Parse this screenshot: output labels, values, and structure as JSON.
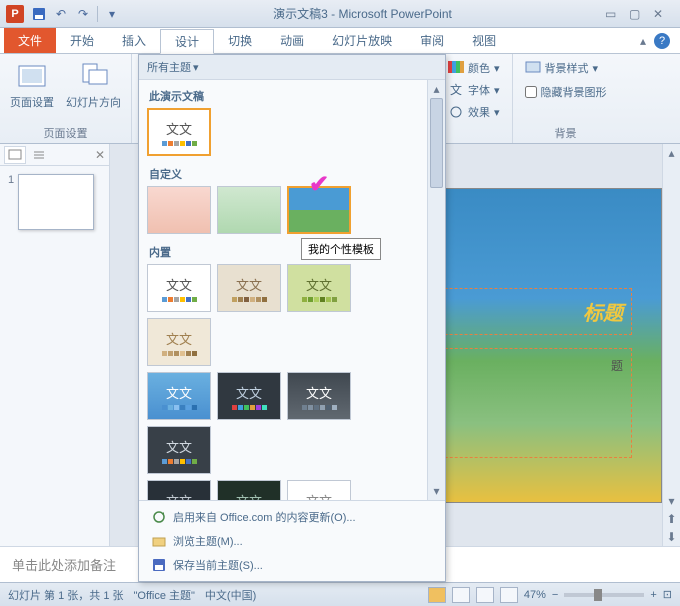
{
  "title": "演示文稿3 - Microsoft PowerPoint",
  "tabs": {
    "file": "文件",
    "home": "开始",
    "insert": "插入",
    "design": "设计",
    "transitions": "切换",
    "animations": "动画",
    "slideshow": "幻灯片放映",
    "review": "审阅",
    "view": "视图"
  },
  "ribbon": {
    "page_setup_group": "页面设置",
    "page_setup": "页面设置",
    "slide_orientation": "幻灯片方向",
    "colors": "颜色",
    "fonts": "字体",
    "effects": "效果",
    "bg_styles": "背景样式",
    "hide_bg_graphics": "隐藏背景图形",
    "background_group": "背景"
  },
  "gallery": {
    "all_themes": "所有主题",
    "this_presentation": "此演示文稿",
    "custom": "自定义",
    "builtin": "内置",
    "thumb_text": "文文",
    "tooltip": "我的个性模板",
    "enable_office_content": "启用来自 Office.com 的内容更新(O)...",
    "browse_themes": "浏览主题(M)...",
    "save_current_theme": "保存当前主题(S)..."
  },
  "slide": {
    "title_placeholder": "标题",
    "subtitle_placeholder": "题"
  },
  "notes": "单击此处添加备注",
  "status": {
    "slide_info": "幻灯片 第 1 张，共 1 张",
    "theme": "\"Office 主题\"",
    "language": "中文(中国)",
    "zoom": "47%"
  },
  "colors": {
    "accent": "#e2572e",
    "sw1": "#5b9bd5",
    "sw2": "#ed7d31",
    "sw3": "#a5a5a5",
    "sw4": "#ffc000",
    "sw5": "#4472c4",
    "sw6": "#70ad47"
  }
}
